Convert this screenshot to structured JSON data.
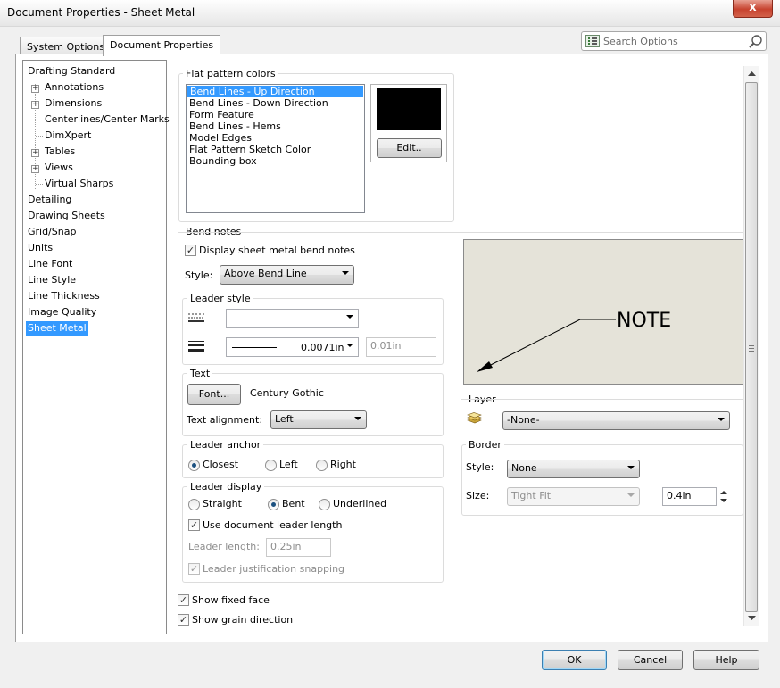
{
  "window": {
    "title": "Document Properties - Sheet Metal",
    "close_glyph": "x"
  },
  "tabs": {
    "system": "System Options",
    "document": "Document Properties"
  },
  "search": {
    "placeholder": "Search Options"
  },
  "tree": {
    "items": [
      {
        "label": "Drafting Standard",
        "level": 0,
        "expander": false
      },
      {
        "label": "Annotations",
        "level": 1,
        "expander": true
      },
      {
        "label": "Dimensions",
        "level": 1,
        "expander": true
      },
      {
        "label": "Centerlines/Center Marks",
        "level": 1,
        "expander": false
      },
      {
        "label": "DimXpert",
        "level": 1,
        "expander": false
      },
      {
        "label": "Tables",
        "level": 1,
        "expander": true
      },
      {
        "label": "Views",
        "level": 1,
        "expander": true
      },
      {
        "label": "Virtual Sharps",
        "level": 1,
        "expander": false
      },
      {
        "label": "Detailing",
        "level": 0,
        "expander": false
      },
      {
        "label": "Drawing Sheets",
        "level": 0,
        "expander": false
      },
      {
        "label": "Grid/Snap",
        "level": 0,
        "expander": false
      },
      {
        "label": "Units",
        "level": 0,
        "expander": false
      },
      {
        "label": "Line Font",
        "level": 0,
        "expander": false
      },
      {
        "label": "Line Style",
        "level": 0,
        "expander": false
      },
      {
        "label": "Line Thickness",
        "level": 0,
        "expander": false
      },
      {
        "label": "Image Quality",
        "level": 0,
        "expander": false
      },
      {
        "label": "Sheet Metal",
        "level": 0,
        "expander": false,
        "selected": true
      }
    ]
  },
  "flat_pattern": {
    "title": "Flat pattern colors",
    "items": [
      "Bend Lines - Up Direction",
      "Bend Lines - Down Direction",
      "Form Feature",
      "Bend Lines - Hems",
      "Model Edges",
      "Flat Pattern Sketch Color",
      "Bounding box"
    ],
    "selected_index": 0,
    "swatch_color": "#000000",
    "edit_label": "Edit.."
  },
  "bend_notes": {
    "title": "Bend notes",
    "display_label": "Display sheet metal bend notes",
    "display_checked": true,
    "style_label": "Style:",
    "style_value": "Above Bend Line",
    "preview_text": "NOTE"
  },
  "leader_style": {
    "title": "Leader style",
    "thickness_value": "0.0071in",
    "custom_thickness": "0.01in"
  },
  "text": {
    "title": "Text",
    "font_button": "Font...",
    "font_name": "Century Gothic",
    "alignment_label": "Text alignment:",
    "alignment_value": "Left"
  },
  "leader_anchor": {
    "title": "Leader anchor",
    "options": [
      "Closest",
      "Left",
      "Right"
    ],
    "selected": "Closest"
  },
  "leader_display": {
    "title": "Leader display",
    "options": [
      "Straight",
      "Bent",
      "Underlined"
    ],
    "selected": "Bent",
    "use_doc_length_label": "Use document leader length",
    "use_doc_length_checked": true,
    "length_label": "Leader length:",
    "length_value": "0.25in",
    "justification_label": "Leader justification snapping",
    "justification_checked": true
  },
  "layer": {
    "title": "Layer",
    "value": "-None-"
  },
  "border": {
    "title": "Border",
    "style_label": "Style:",
    "style_value": "None",
    "size_label": "Size:",
    "size_value": "Tight Fit",
    "size_number": "0.4in"
  },
  "bottom_checks": {
    "fixed_face_label": "Show fixed face",
    "fixed_face_checked": true,
    "grain_label": "Show grain direction",
    "grain_checked": true
  },
  "footer": {
    "ok": "OK",
    "cancel": "Cancel",
    "help": "Help"
  },
  "check_glyph": "✓",
  "colors": {
    "selection": "#3399ff",
    "preview_bg": "#e5e3d9"
  }
}
